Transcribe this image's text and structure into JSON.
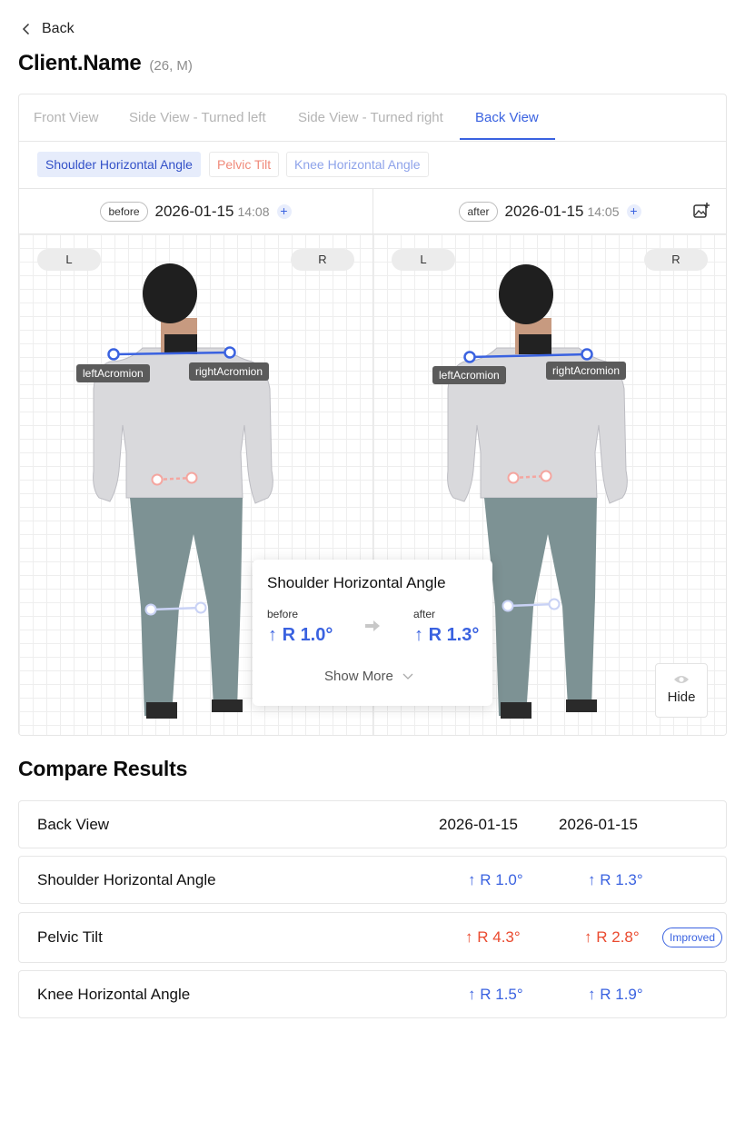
{
  "nav": {
    "back_label": "Back"
  },
  "client": {
    "name": "Client.Name",
    "meta": "(26, M)"
  },
  "tabs": [
    {
      "label": "Front View",
      "active": false
    },
    {
      "label": "Side View - Turned left",
      "active": false
    },
    {
      "label": "Side View - Turned right",
      "active": false
    },
    {
      "label": "Back View",
      "active": true
    }
  ],
  "chips": [
    {
      "label": "Shoulder Horizontal Angle",
      "selected": true
    },
    {
      "label": "Pelvic Tilt",
      "selected": false
    },
    {
      "label": "Knee Horizontal Angle",
      "selected": false
    }
  ],
  "compare": {
    "before": {
      "tag": "before",
      "date": "2026-01-15",
      "time": "14:08",
      "side_left": "L",
      "side_right": "R",
      "left_landmark": "leftAcromion",
      "right_landmark": "rightAcromion"
    },
    "after": {
      "tag": "after",
      "date": "2026-01-15",
      "time": "14:05",
      "side_left": "L",
      "side_right": "R",
      "left_landmark": "leftAcromion",
      "right_landmark": "rightAcromion"
    }
  },
  "popup": {
    "title": "Shoulder Horizontal Angle",
    "before_label": "before",
    "before_value": "R 1.0°",
    "after_label": "after",
    "after_value": "R 1.3°",
    "show_more": "Show More"
  },
  "hide_label": "Hide",
  "results": {
    "title": "Compare Results",
    "header": {
      "label": "Back View",
      "col1": "2026-01-15",
      "col2": "2026-01-15"
    },
    "rows": [
      {
        "label": "Shoulder Horizontal Angle",
        "before": "R 1.0°",
        "after": "R 1.3°",
        "color": "#3a62e0",
        "badge": ""
      },
      {
        "label": "Pelvic Tilt",
        "before": "R 4.3°",
        "after": "R 2.8°",
        "color": "#ea4a2f",
        "badge": "Improved"
      },
      {
        "label": "Knee Horizontal Angle",
        "before": "R 1.5°",
        "after": "R 1.9°",
        "color": "#3a62e0",
        "badge": ""
      }
    ]
  },
  "colors": {
    "accent": "#3a62e0",
    "alert": "#ea4a2f",
    "pelvis_marker": "#f4a6a0",
    "knee_marker": "#c9d2f5"
  }
}
